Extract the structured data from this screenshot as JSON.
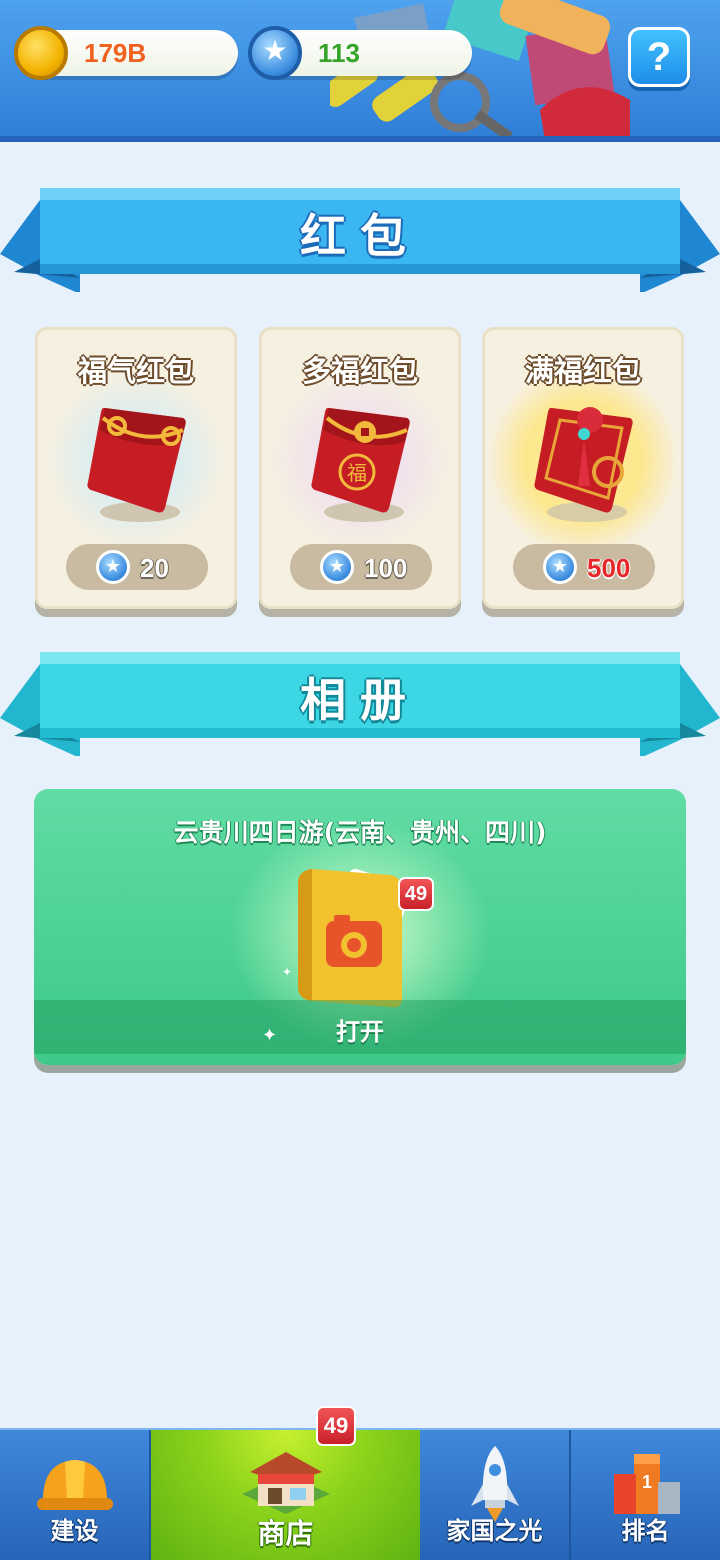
{
  "header": {
    "coins": "179B",
    "gems": "113",
    "help_label": "?"
  },
  "red_envelope_section": {
    "title": "红包",
    "cards": [
      {
        "title": "福气红包",
        "price": "20",
        "icon": "red-envelope-icon"
      },
      {
        "title": "多福红包",
        "price": "100",
        "icon": "red-envelope-fu-icon"
      },
      {
        "title": "满福红包",
        "price": "500",
        "icon": "red-envelope-knot-icon"
      }
    ]
  },
  "album_section": {
    "title": "相册",
    "album": {
      "title": "云贵川四日游(云南、贵州、四川)",
      "badge": "49",
      "open_label": "打开"
    }
  },
  "bottom_nav": {
    "items": [
      {
        "label": "建设",
        "icon": "hard-hat-icon"
      },
      {
        "label": "商店",
        "icon": "shop-icon"
      },
      {
        "label": "家国之光",
        "icon": "rocket-icon"
      },
      {
        "label": "排名",
        "icon": "ranking-podium-icon"
      }
    ],
    "shop_badge": "49"
  },
  "colors": {
    "header_blue": "#3a8de4",
    "ribbon_blue": "#2fa8ea",
    "ribbon_teal": "#2ed3e0",
    "album_green": "#4fd59a",
    "nav_active_green": "#8ad21b",
    "envelope_red": "#c8202a"
  }
}
